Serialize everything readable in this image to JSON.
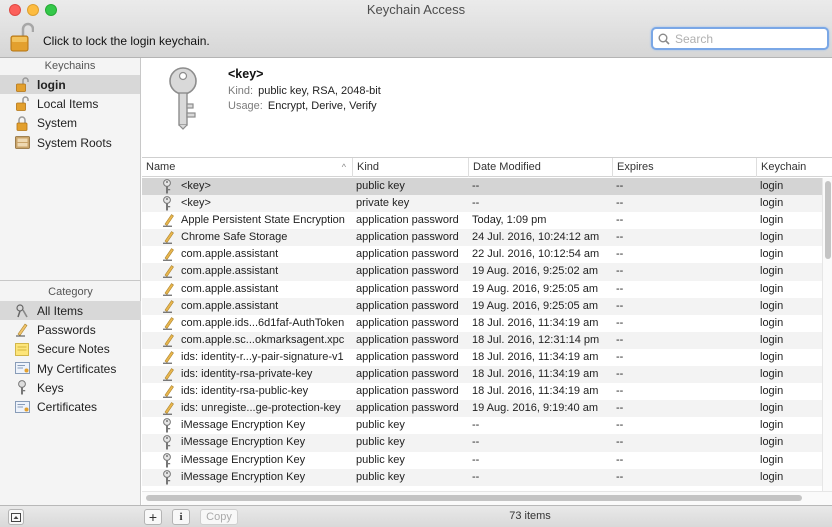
{
  "window": {
    "title": "Keychain Access"
  },
  "toolbar": {
    "lock_message": "Click to lock the login keychain.",
    "search_placeholder": "Search"
  },
  "sidebar": {
    "keychains_header": "Keychains",
    "keychains": [
      {
        "label": "login",
        "icon": "unlocked-padlock-icon",
        "selected": true
      },
      {
        "label": "Local Items",
        "icon": "unlocked-padlock-icon",
        "selected": false
      },
      {
        "label": "System",
        "icon": "locked-padlock-icon",
        "selected": false
      },
      {
        "label": "System Roots",
        "icon": "cabinet-icon",
        "selected": false
      }
    ],
    "category_header": "Category",
    "categories": [
      {
        "label": "All Items",
        "icon": "all-items-icon",
        "selected": true
      },
      {
        "label": "Passwords",
        "icon": "pencil-icon",
        "selected": false
      },
      {
        "label": "Secure Notes",
        "icon": "note-icon",
        "selected": false
      },
      {
        "label": "My Certificates",
        "icon": "certificate-icon",
        "selected": false
      },
      {
        "label": "Keys",
        "icon": "key-icon",
        "selected": false
      },
      {
        "label": "Certificates",
        "icon": "certificate-icon",
        "selected": false
      }
    ]
  },
  "detail": {
    "name": "<key>",
    "kind_label": "Kind:",
    "kind_value": "public key, RSA, 2048-bit",
    "usage_label": "Usage:",
    "usage_value": "Encrypt, Derive, Verify"
  },
  "table": {
    "columns": [
      "Name",
      "Kind",
      "Date Modified",
      "Expires",
      "Keychain"
    ],
    "rows": [
      {
        "icon": "key",
        "name": "<key>",
        "kind": "public key",
        "date": "--",
        "expires": "--",
        "keychain": "login",
        "selected": true
      },
      {
        "icon": "key",
        "name": "<key>",
        "kind": "private key",
        "date": "--",
        "expires": "--",
        "keychain": "login"
      },
      {
        "icon": "pencil",
        "name": "Apple Persistent State Encryption",
        "kind": "application password",
        "date": "Today, 1:09 pm",
        "expires": "--",
        "keychain": "login"
      },
      {
        "icon": "pencil",
        "name": "Chrome Safe Storage",
        "kind": "application password",
        "date": "24 Jul. 2016, 10:24:12 am",
        "expires": "--",
        "keychain": "login"
      },
      {
        "icon": "pencil",
        "name": "com.apple.assistant",
        "kind": "application password",
        "date": "22 Jul. 2016, 10:12:54 am",
        "expires": "--",
        "keychain": "login"
      },
      {
        "icon": "pencil",
        "name": "com.apple.assistant",
        "kind": "application password",
        "date": "19 Aug. 2016, 9:25:02 am",
        "expires": "--",
        "keychain": "login"
      },
      {
        "icon": "pencil",
        "name": "com.apple.assistant",
        "kind": "application password",
        "date": "19 Aug. 2016, 9:25:05 am",
        "expires": "--",
        "keychain": "login"
      },
      {
        "icon": "pencil",
        "name": "com.apple.assistant",
        "kind": "application password",
        "date": "19 Aug. 2016, 9:25:05 am",
        "expires": "--",
        "keychain": "login"
      },
      {
        "icon": "pencil",
        "name": "com.apple.ids...6d1faf-AuthToken",
        "kind": "application password",
        "date": "18 Jul. 2016, 11:34:19 am",
        "expires": "--",
        "keychain": "login"
      },
      {
        "icon": "pencil",
        "name": "com.apple.sc...okmarksagent.xpc",
        "kind": "application password",
        "date": "18 Jul. 2016, 12:31:14 pm",
        "expires": "--",
        "keychain": "login"
      },
      {
        "icon": "pencil",
        "name": "ids: identity-r...y-pair-signature-v1",
        "kind": "application password",
        "date": "18 Jul. 2016, 11:34:19 am",
        "expires": "--",
        "keychain": "login"
      },
      {
        "icon": "pencil",
        "name": "ids: identity-rsa-private-key",
        "kind": "application password",
        "date": "18 Jul. 2016, 11:34:19 am",
        "expires": "--",
        "keychain": "login"
      },
      {
        "icon": "pencil",
        "name": "ids: identity-rsa-public-key",
        "kind": "application password",
        "date": "18 Jul. 2016, 11:34:19 am",
        "expires": "--",
        "keychain": "login"
      },
      {
        "icon": "pencil",
        "name": "ids: unregiste...ge-protection-key",
        "kind": "application password",
        "date": "19 Aug. 2016, 9:19:40 am",
        "expires": "--",
        "keychain": "login"
      },
      {
        "icon": "key",
        "name": "iMessage Encryption Key",
        "kind": "public key",
        "date": "--",
        "expires": "--",
        "keychain": "login"
      },
      {
        "icon": "key",
        "name": "iMessage Encryption Key",
        "kind": "public key",
        "date": "--",
        "expires": "--",
        "keychain": "login"
      },
      {
        "icon": "key",
        "name": "iMessage Encryption Key",
        "kind": "public key",
        "date": "--",
        "expires": "--",
        "keychain": "login"
      },
      {
        "icon": "key",
        "name": "iMessage Encryption Key",
        "kind": "public key",
        "date": "--",
        "expires": "--",
        "keychain": "login"
      }
    ]
  },
  "bottombar": {
    "add_label": "+",
    "info_label": "i",
    "copy_label": "Copy",
    "item_count": "73 items"
  }
}
